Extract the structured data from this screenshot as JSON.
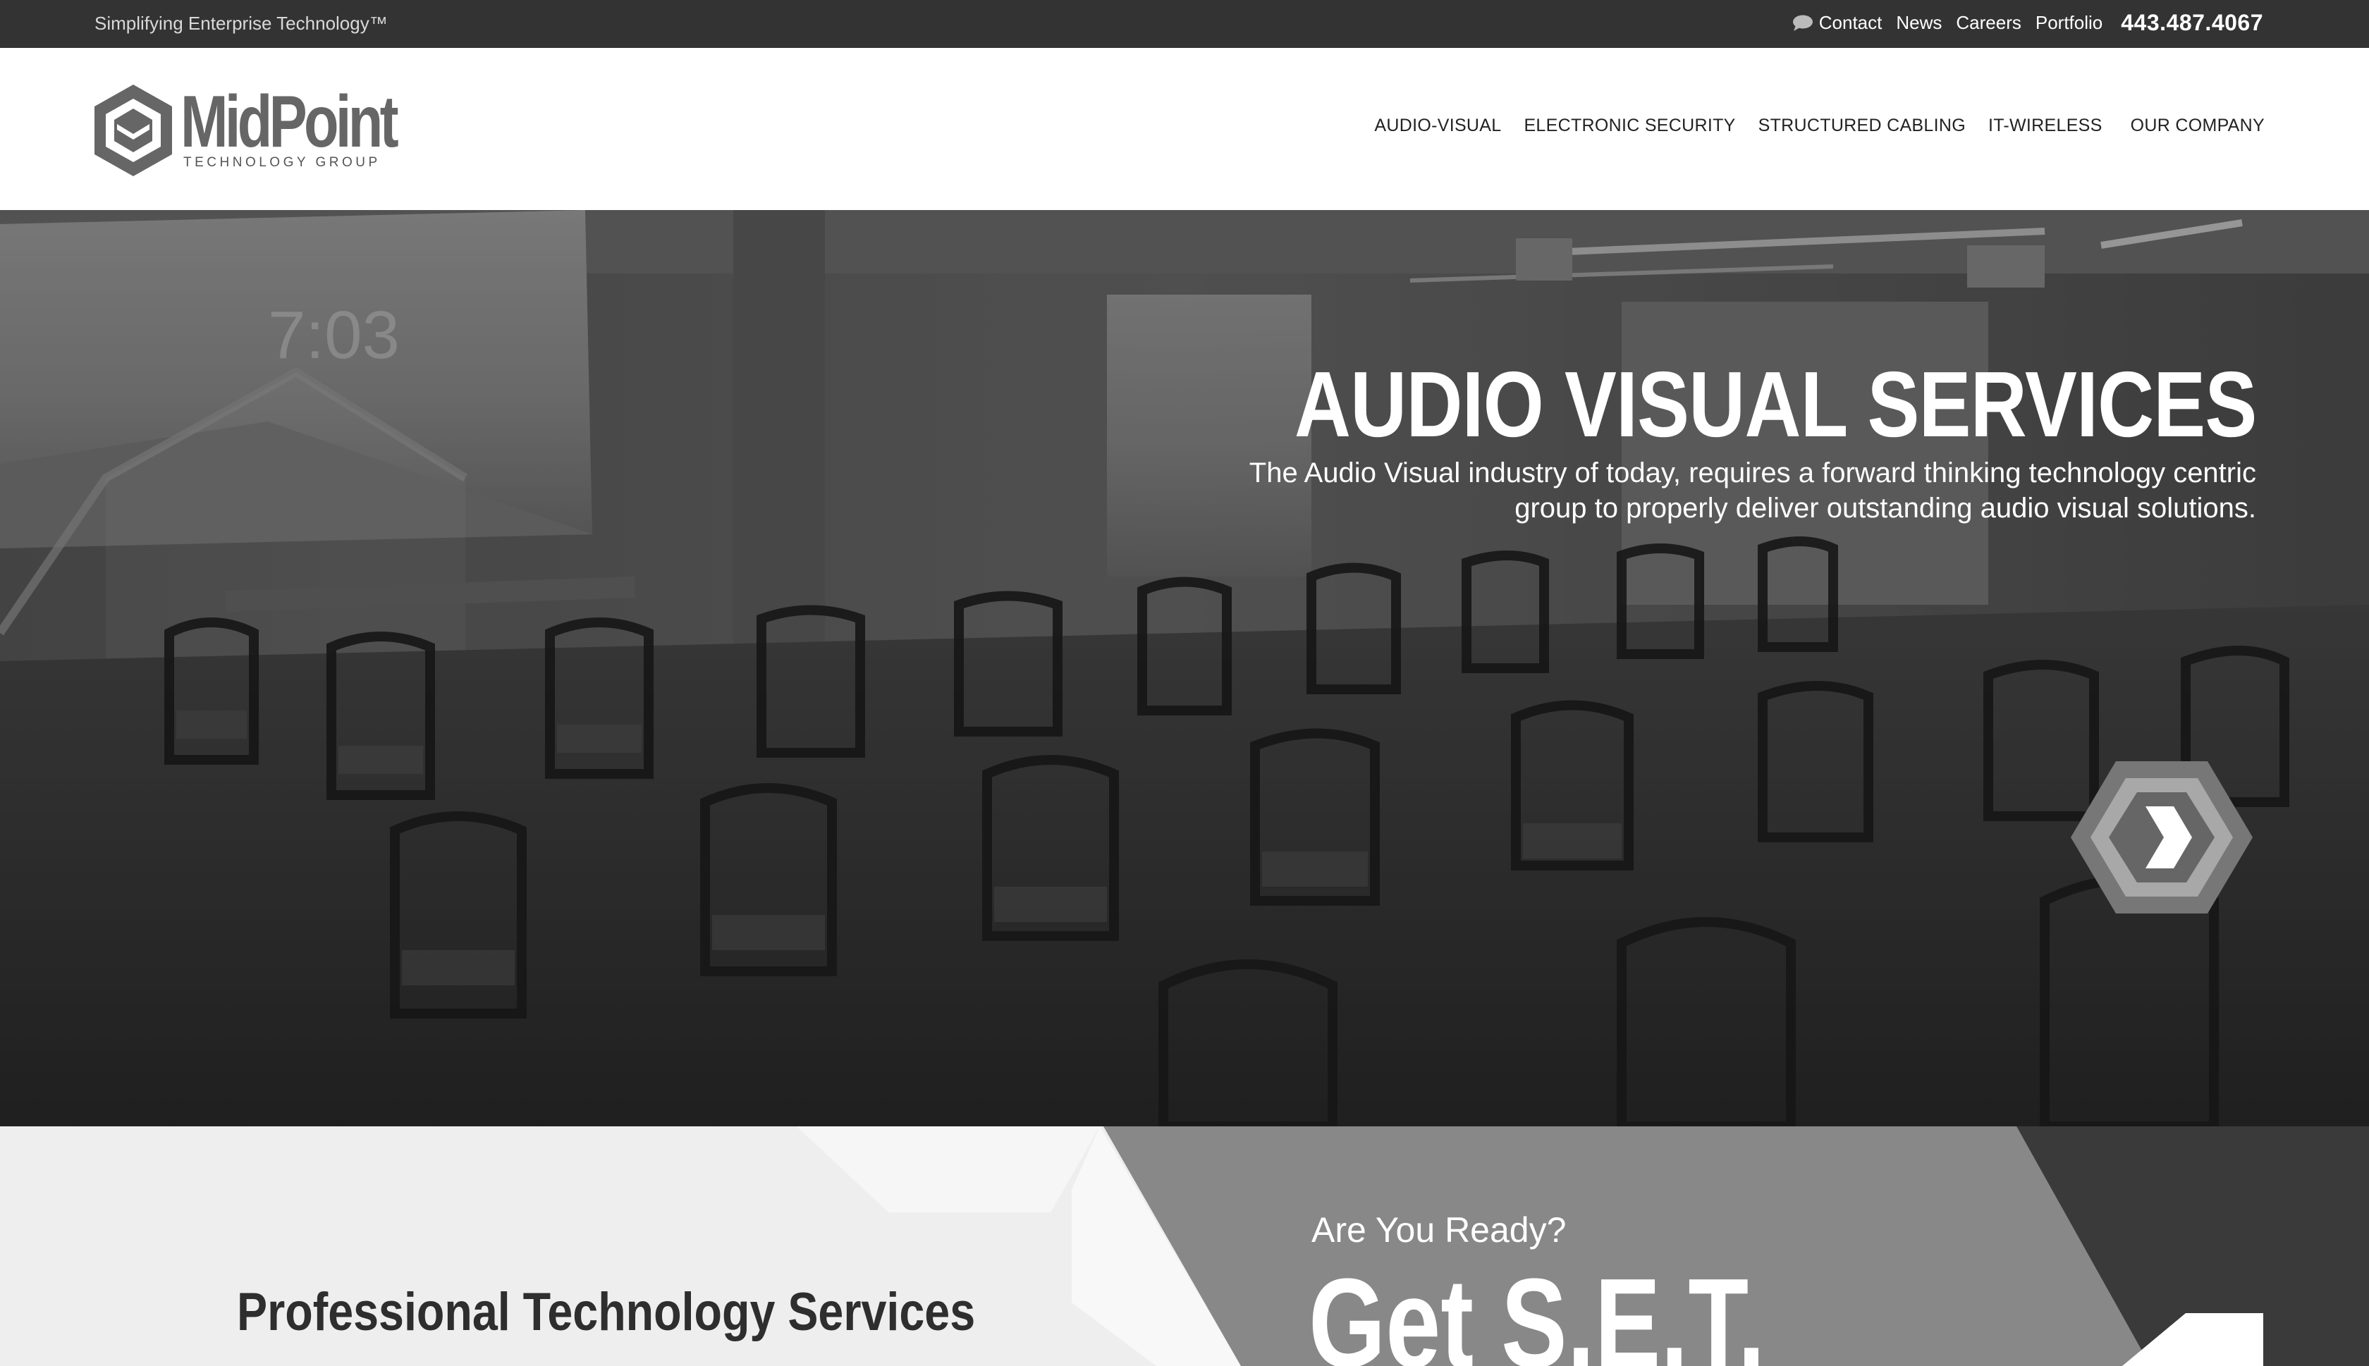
{
  "topbar": {
    "tagline": "Simplifying Enterprise Technology™",
    "links": {
      "contact": "Contact",
      "news": "News",
      "careers": "Careers",
      "portfolio": "Portfolio"
    },
    "phone": "443.487.4067"
  },
  "logo": {
    "name": "MidPoint",
    "subtitle": "TECHNOLOGY GROUP"
  },
  "nav": {
    "audio_visual": "AUDIO-VISUAL",
    "electronic_security": "ELECTRONIC SECURITY",
    "structured_cabling": "STRUCTURED CABLING",
    "it_wireless": "IT-WIRELESS",
    "our_company": "OUR COMPANY"
  },
  "hero": {
    "title": "AUDIO VISUAL SERVICES",
    "description": "The Audio Visual industry of today, requires a forward thinking technology centric group to properly deliver outstanding audio visual solutions.",
    "screen_clock": "7:03"
  },
  "services": {
    "title": "Professional Technology Services"
  },
  "cta": {
    "question": "Are You Ready?",
    "headline": "Get S.E.T."
  },
  "colors": {
    "topbar": "#333333",
    "phone": "#9a9a9a",
    "hero_overlay": "#3d3d3d",
    "cta_panel": "#888888"
  }
}
